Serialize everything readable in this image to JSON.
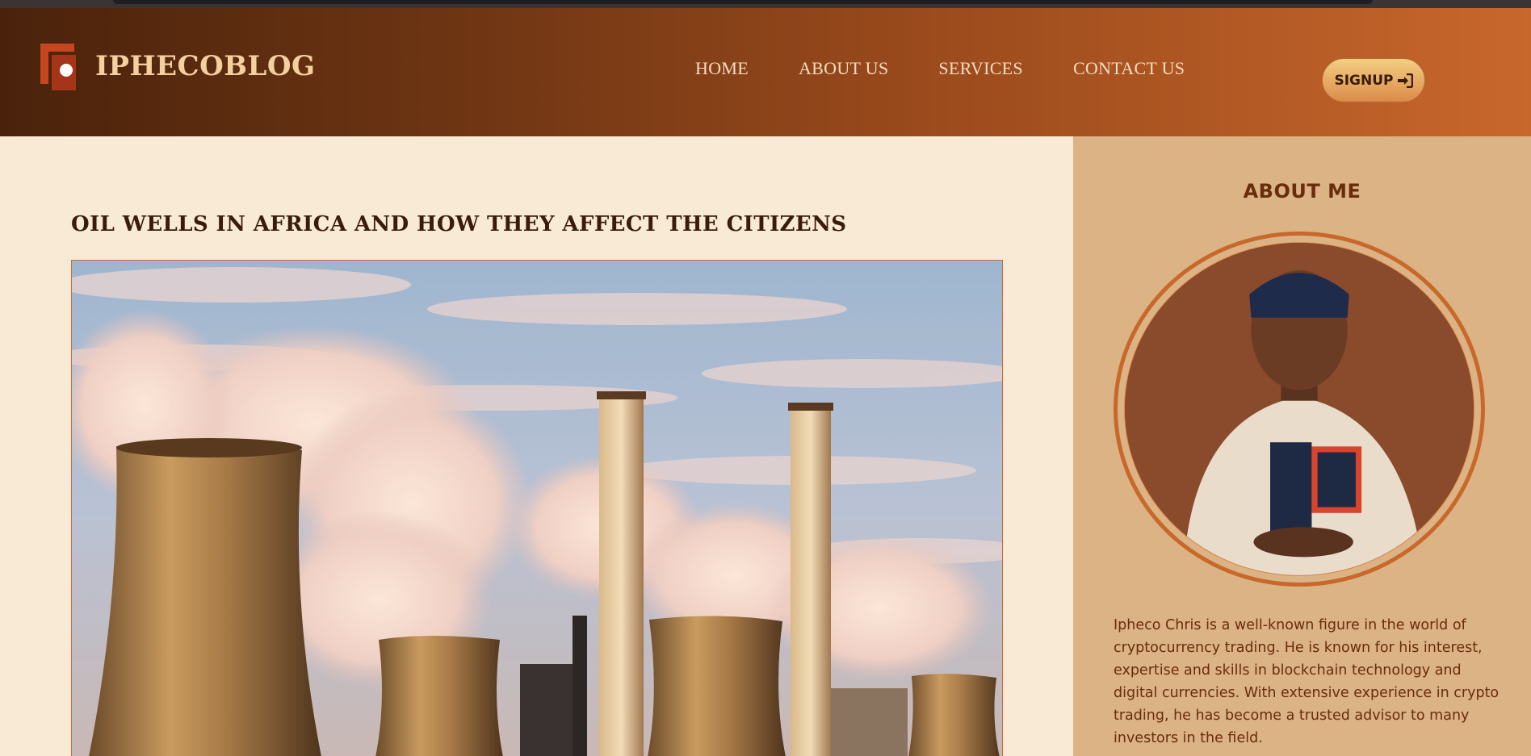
{
  "site": {
    "brand": "IPHECOBLOG"
  },
  "nav": {
    "items": [
      "HOME",
      "ABOUT US",
      "SERVICES",
      "CONTACT US"
    ]
  },
  "header": {
    "signup_label": "SIGNUP"
  },
  "post": {
    "title": "OIL WELLS IN AFRICA AND HOW THEY AFFECT THE CITIZENS",
    "image_alt": "Cooling towers and chimneys emitting steam under a cloudy sky"
  },
  "sidebar": {
    "title": "ABOUT ME",
    "bio": "Ipheco Chris is a well-known figure in the world of cryptocurrency trading. He is known for his interest, expertise and skills in blockchain technology and digital currencies. With extensive experience in crypto trading, he has become a trusted advisor to many investors in the field."
  },
  "colors": {
    "header_gradient_start": "#4a220b",
    "header_gradient_end": "#c8672c",
    "page_background": "#f9ead6",
    "sidebar_background": "#dbb384",
    "accent": "#c8682a"
  },
  "icons": {
    "logo": "blog-logo-icon",
    "signup": "sign-in-icon"
  }
}
